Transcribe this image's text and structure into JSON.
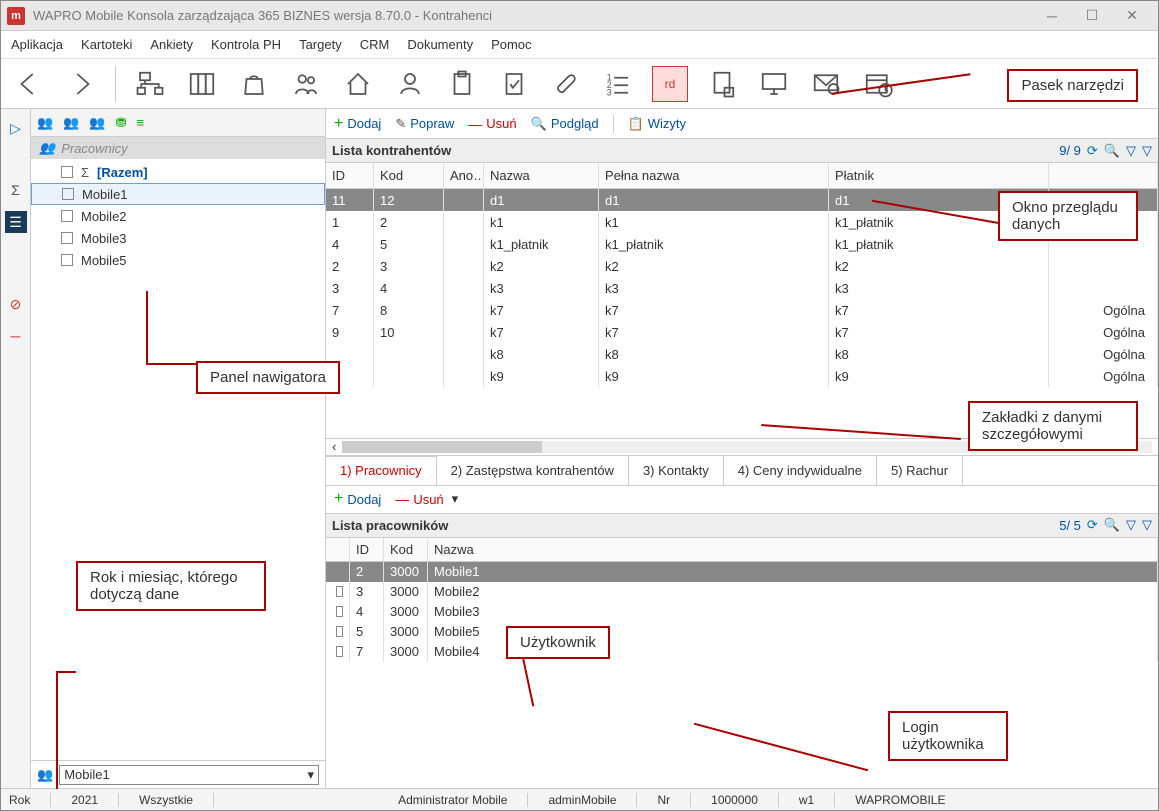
{
  "window": {
    "title": "WAPRO Mobile Konsola zarządzająca 365 BIZNES wersja 8.70.0 - Kontrahenci",
    "app_icon_letter": "m"
  },
  "menu": [
    "Aplikacja",
    "Kartoteki",
    "Ankiety",
    "Kontrola PH",
    "Targety",
    "CRM",
    "Dokumenty",
    "Pomoc"
  ],
  "toolbar_rd": "rd",
  "nav": {
    "header": "Pracownicy",
    "root": "[Razem]",
    "items": [
      "Mobile1",
      "Mobile2",
      "Mobile3",
      "Mobile5"
    ],
    "selected": "Mobile1",
    "combo_value": "Mobile1"
  },
  "actions": {
    "add": "Dodaj",
    "edit": "Popraw",
    "del": "Usuń",
    "view": "Podgląd",
    "visits": "Wizyty"
  },
  "grid": {
    "title": "Lista kontrahentów",
    "count": "9/ 9",
    "cols": [
      "ID",
      "Kod",
      "Ano…",
      "Nazwa",
      "Pełna nazwa",
      "Płatnik",
      ""
    ],
    "rows": [
      {
        "id": "11",
        "kod": "12",
        "ano": "",
        "nazwa": "d1",
        "pelna": "d1",
        "platnik": "d1",
        "extra": "",
        "sel": true
      },
      {
        "id": "1",
        "kod": "2",
        "ano": "",
        "nazwa": "k1",
        "pelna": "k1",
        "platnik": "k1_płatnik",
        "extra": ""
      },
      {
        "id": "4",
        "kod": "5",
        "ano": "",
        "nazwa": "k1_płatnik",
        "pelna": "k1_płatnik",
        "platnik": "k1_płatnik",
        "extra": ""
      },
      {
        "id": "2",
        "kod": "3",
        "ano": "",
        "nazwa": "k2",
        "pelna": "k2",
        "platnik": "k2",
        "extra": ""
      },
      {
        "id": "3",
        "kod": "4",
        "ano": "",
        "nazwa": "k3",
        "pelna": "k3",
        "platnik": "k3",
        "extra": ""
      },
      {
        "id": "7",
        "kod": "8",
        "ano": "",
        "nazwa": "k7",
        "pelna": "k7",
        "platnik": "k7",
        "extra": "Ogólna"
      },
      {
        "id": "9",
        "kod": "10",
        "ano": "",
        "nazwa": "k7",
        "pelna": "k7",
        "platnik": "k7",
        "extra": "Ogólna"
      },
      {
        "id": "",
        "kod": "",
        "ano": "",
        "nazwa": "k8",
        "pelna": "k8",
        "platnik": "k8",
        "extra": "Ogólna"
      },
      {
        "id": "",
        "kod": "",
        "ano": "",
        "nazwa": "k9",
        "pelna": "k9",
        "platnik": "k9",
        "extra": "Ogólna"
      }
    ]
  },
  "tabs": [
    "1) Pracownicy",
    "2) Zastępstwa kontrahentów",
    "3) Kontakty",
    "4) Ceny indywidualne",
    "5) Rachur"
  ],
  "sub_actions": {
    "add": "Dodaj",
    "del": "Usuń"
  },
  "subgrid": {
    "title": "Lista pracowników",
    "count": "5/ 5",
    "cols": [
      "",
      "ID",
      "Kod",
      "Nazwa"
    ],
    "rows": [
      {
        "id": "2",
        "kod": "3000",
        "nazwa": "Mobile1",
        "sel": true
      },
      {
        "id": "3",
        "kod": "3000",
        "nazwa": "Mobile2"
      },
      {
        "id": "4",
        "kod": "3000",
        "nazwa": "Mobile3"
      },
      {
        "id": "5",
        "kod": "3000",
        "nazwa": "Mobile5"
      },
      {
        "id": "7",
        "kod": "3000",
        "nazwa": "Mobile4"
      }
    ]
  },
  "status": {
    "rok_label": "Rok",
    "rok": "2021",
    "wszystkie": "Wszystkie",
    "user": "Administrator Mobile",
    "login": "adminMobile",
    "nr_label": "Nr",
    "nr": "1000000",
    "w1": "w1",
    "db": "WAPROMOBILE"
  },
  "callouts": {
    "toolbar": "Pasek narzędzi",
    "nav": "Panel nawigatora",
    "data": "Okno przeglądu danych",
    "tabs": "Zakładki z danymi szczegółowymi",
    "user": "Użytkownik",
    "login": "Login użytkownika",
    "rok": "Rok i miesiąc, którego dotyczą dane"
  }
}
